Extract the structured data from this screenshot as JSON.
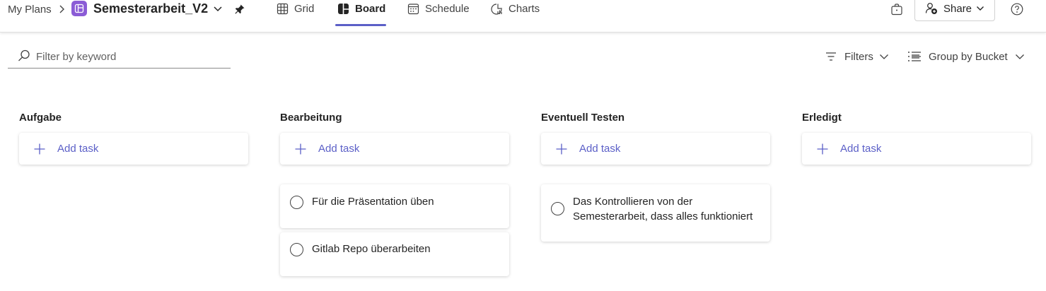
{
  "header": {
    "breadcrumb": "My Plans",
    "plan_title": "Semesterarbeit_V2",
    "tabs": [
      {
        "label": "Grid",
        "icon": "grid-icon"
      },
      {
        "label": "Board",
        "icon": "board-icon",
        "active": true
      },
      {
        "label": "Schedule",
        "icon": "calendar-icon"
      },
      {
        "label": "Charts",
        "icon": "chart-icon"
      }
    ],
    "share_label": "Share",
    "accent_color": "#5b5fc7",
    "plan_icon_color": "#8b5cd6"
  },
  "toolbar": {
    "filter_placeholder": "Filter by keyword",
    "filters_label": "Filters",
    "groupby_label": "Group by Bucket"
  },
  "board": {
    "add_task_label": "Add task",
    "buckets": [
      {
        "title": "Aufgabe",
        "tasks": []
      },
      {
        "title": "Bearbeitung",
        "tasks": [
          {
            "title": "Für die Präsentation üben"
          },
          {
            "title": "Gitlab Repo überarbeiten"
          }
        ]
      },
      {
        "title": "Eventuell Testen",
        "tasks": [
          {
            "title": "Das Kontrollieren von der Semesterarbeit, dass alles funktioniert"
          }
        ]
      },
      {
        "title": "Erledigt",
        "tasks": []
      }
    ]
  }
}
